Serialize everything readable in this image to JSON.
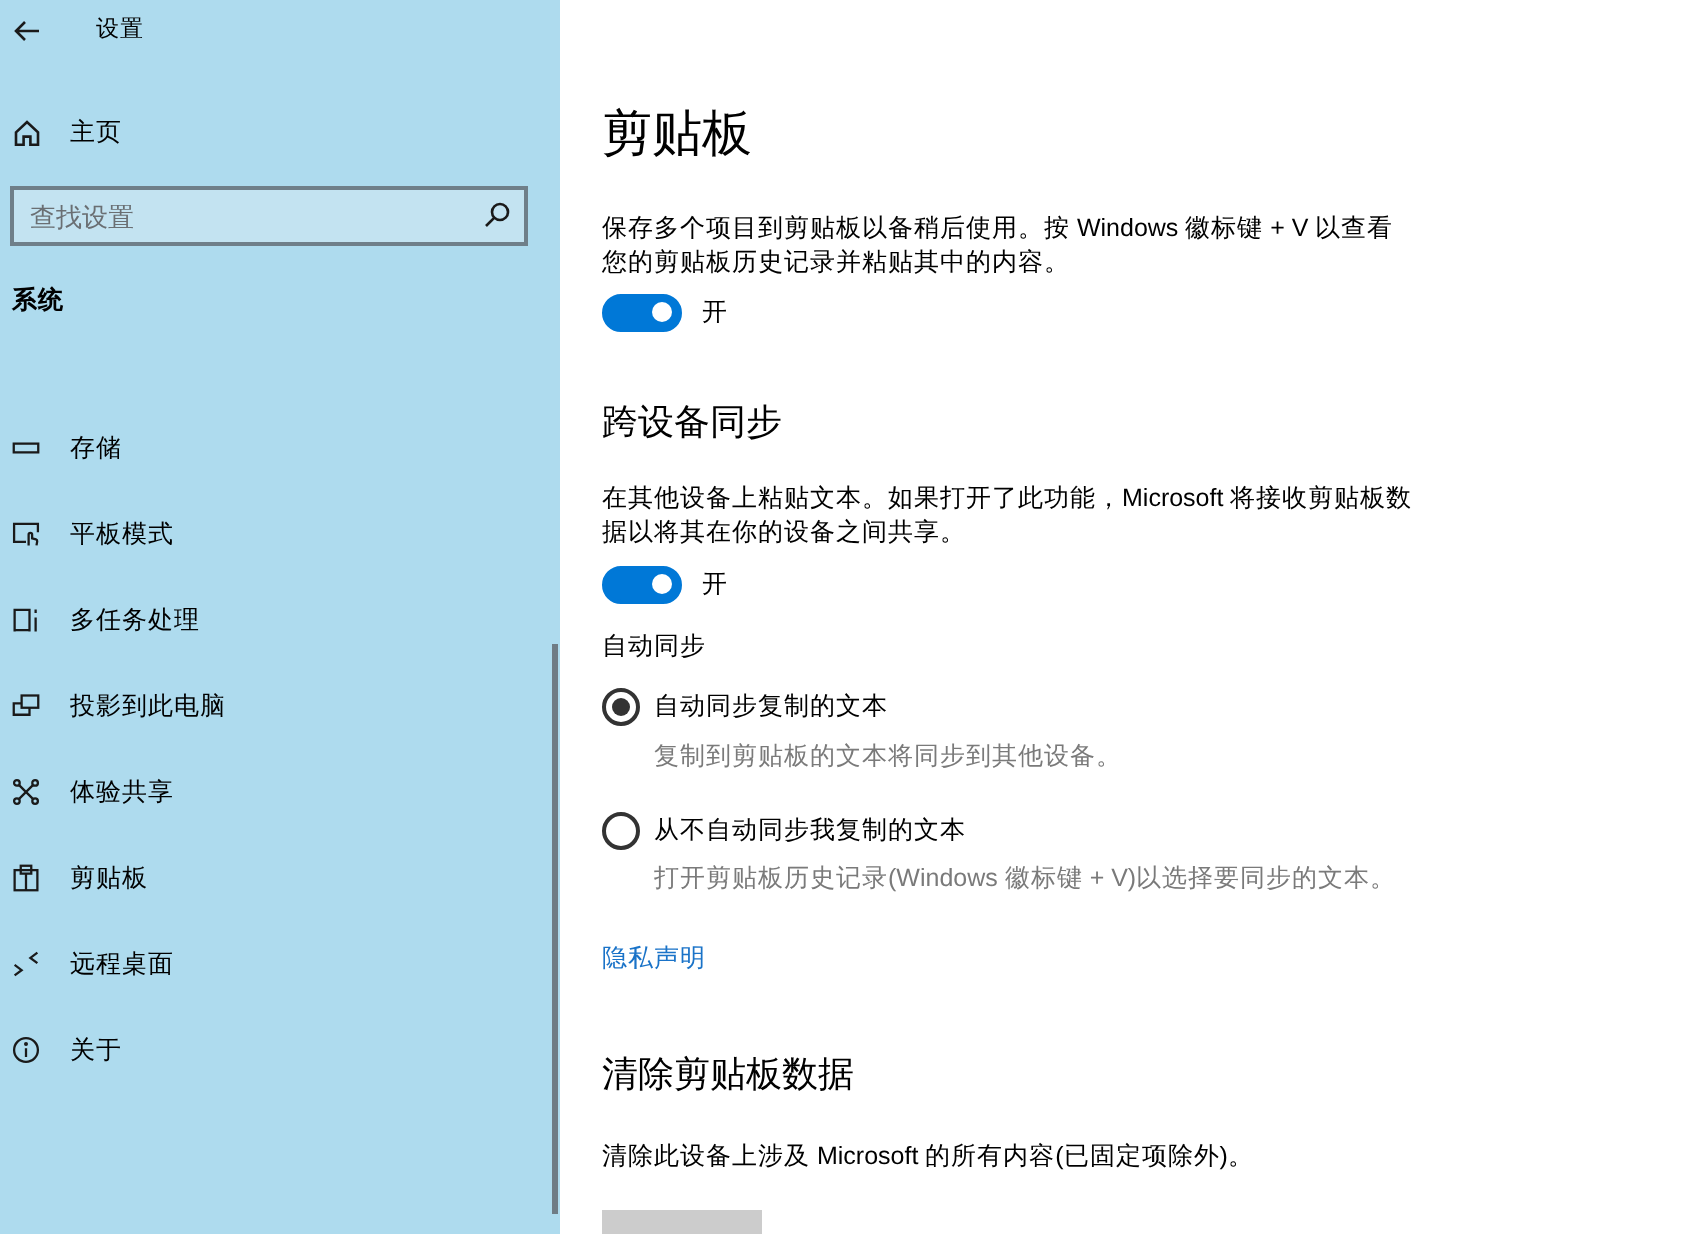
{
  "window": {
    "title": "设置"
  },
  "sidebar": {
    "home": "主页",
    "search": {
      "placeholder": "查找设置"
    },
    "section": "系统",
    "items": [
      {
        "label": "存储"
      },
      {
        "label": "平板模式"
      },
      {
        "label": "多任务处理"
      },
      {
        "label": "投影到此电脑"
      },
      {
        "label": "体验共享"
      },
      {
        "label": "剪贴板"
      },
      {
        "label": "远程桌面"
      },
      {
        "label": "关于"
      }
    ]
  },
  "page": {
    "title": "剪贴板"
  },
  "clipboard_history": {
    "description": "保存多个项目到剪贴板以备稍后使用。按 Windows 徽标键 + V 以查看您的剪贴板历史记录并粘贴其中的内容。",
    "toggle": {
      "on": true,
      "label": "开"
    }
  },
  "sync": {
    "heading": "跨设备同步",
    "description": "在其他设备上粘贴文本。如果打开了此功能，Microsoft 将接收剪贴板数据以将其在你的设备之间共享。",
    "toggle": {
      "on": true,
      "label": "开"
    },
    "auto_sync": {
      "label": "自动同步",
      "options": [
        {
          "label": "自动同步复制的文本",
          "description": "复制到剪贴板的文本将同步到其他设备。",
          "selected": true
        },
        {
          "label": "从不自动同步我复制的文本",
          "description": "打开剪贴板历史记录(Windows 徽标键 + V)以选择要同步的文本。",
          "selected": false
        }
      ]
    }
  },
  "privacy_link": "隐私声明",
  "clear_data": {
    "heading": "清除剪贴板数据",
    "description": "清除此设备上涉及 Microsoft 的所有内容(已固定项除外)。"
  }
}
